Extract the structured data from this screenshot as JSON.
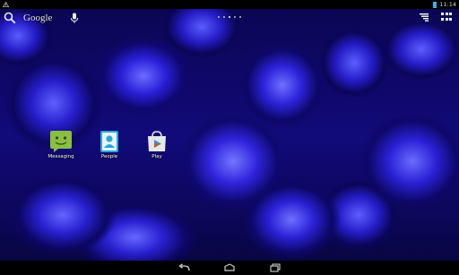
{
  "status_bar": {
    "time": "11:14",
    "left_icon": "warning-triangle-icon",
    "battery_color": "#33b5e5"
  },
  "search": {
    "label": "Google",
    "icon": "search-icon",
    "mic": "mic-icon"
  },
  "workspace": {
    "page_count": 5,
    "current_page_index": 2
  },
  "tray": {
    "voice_icon": "voice-list-icon",
    "apps_icon": "apps-grid-icon"
  },
  "shortcuts": [
    {
      "label": "Messaging",
      "icon": "messaging-icon",
      "color": "#8bbf3f"
    },
    {
      "label": "People",
      "icon": "people-icon",
      "color": "#2aa8d8"
    },
    {
      "label": "Play",
      "icon": "play-store-icon",
      "color": "#e7e7e7"
    }
  ],
  "nav_bar": {
    "back": "back-icon",
    "home": "home-icon",
    "recents": "recents-icon"
  }
}
